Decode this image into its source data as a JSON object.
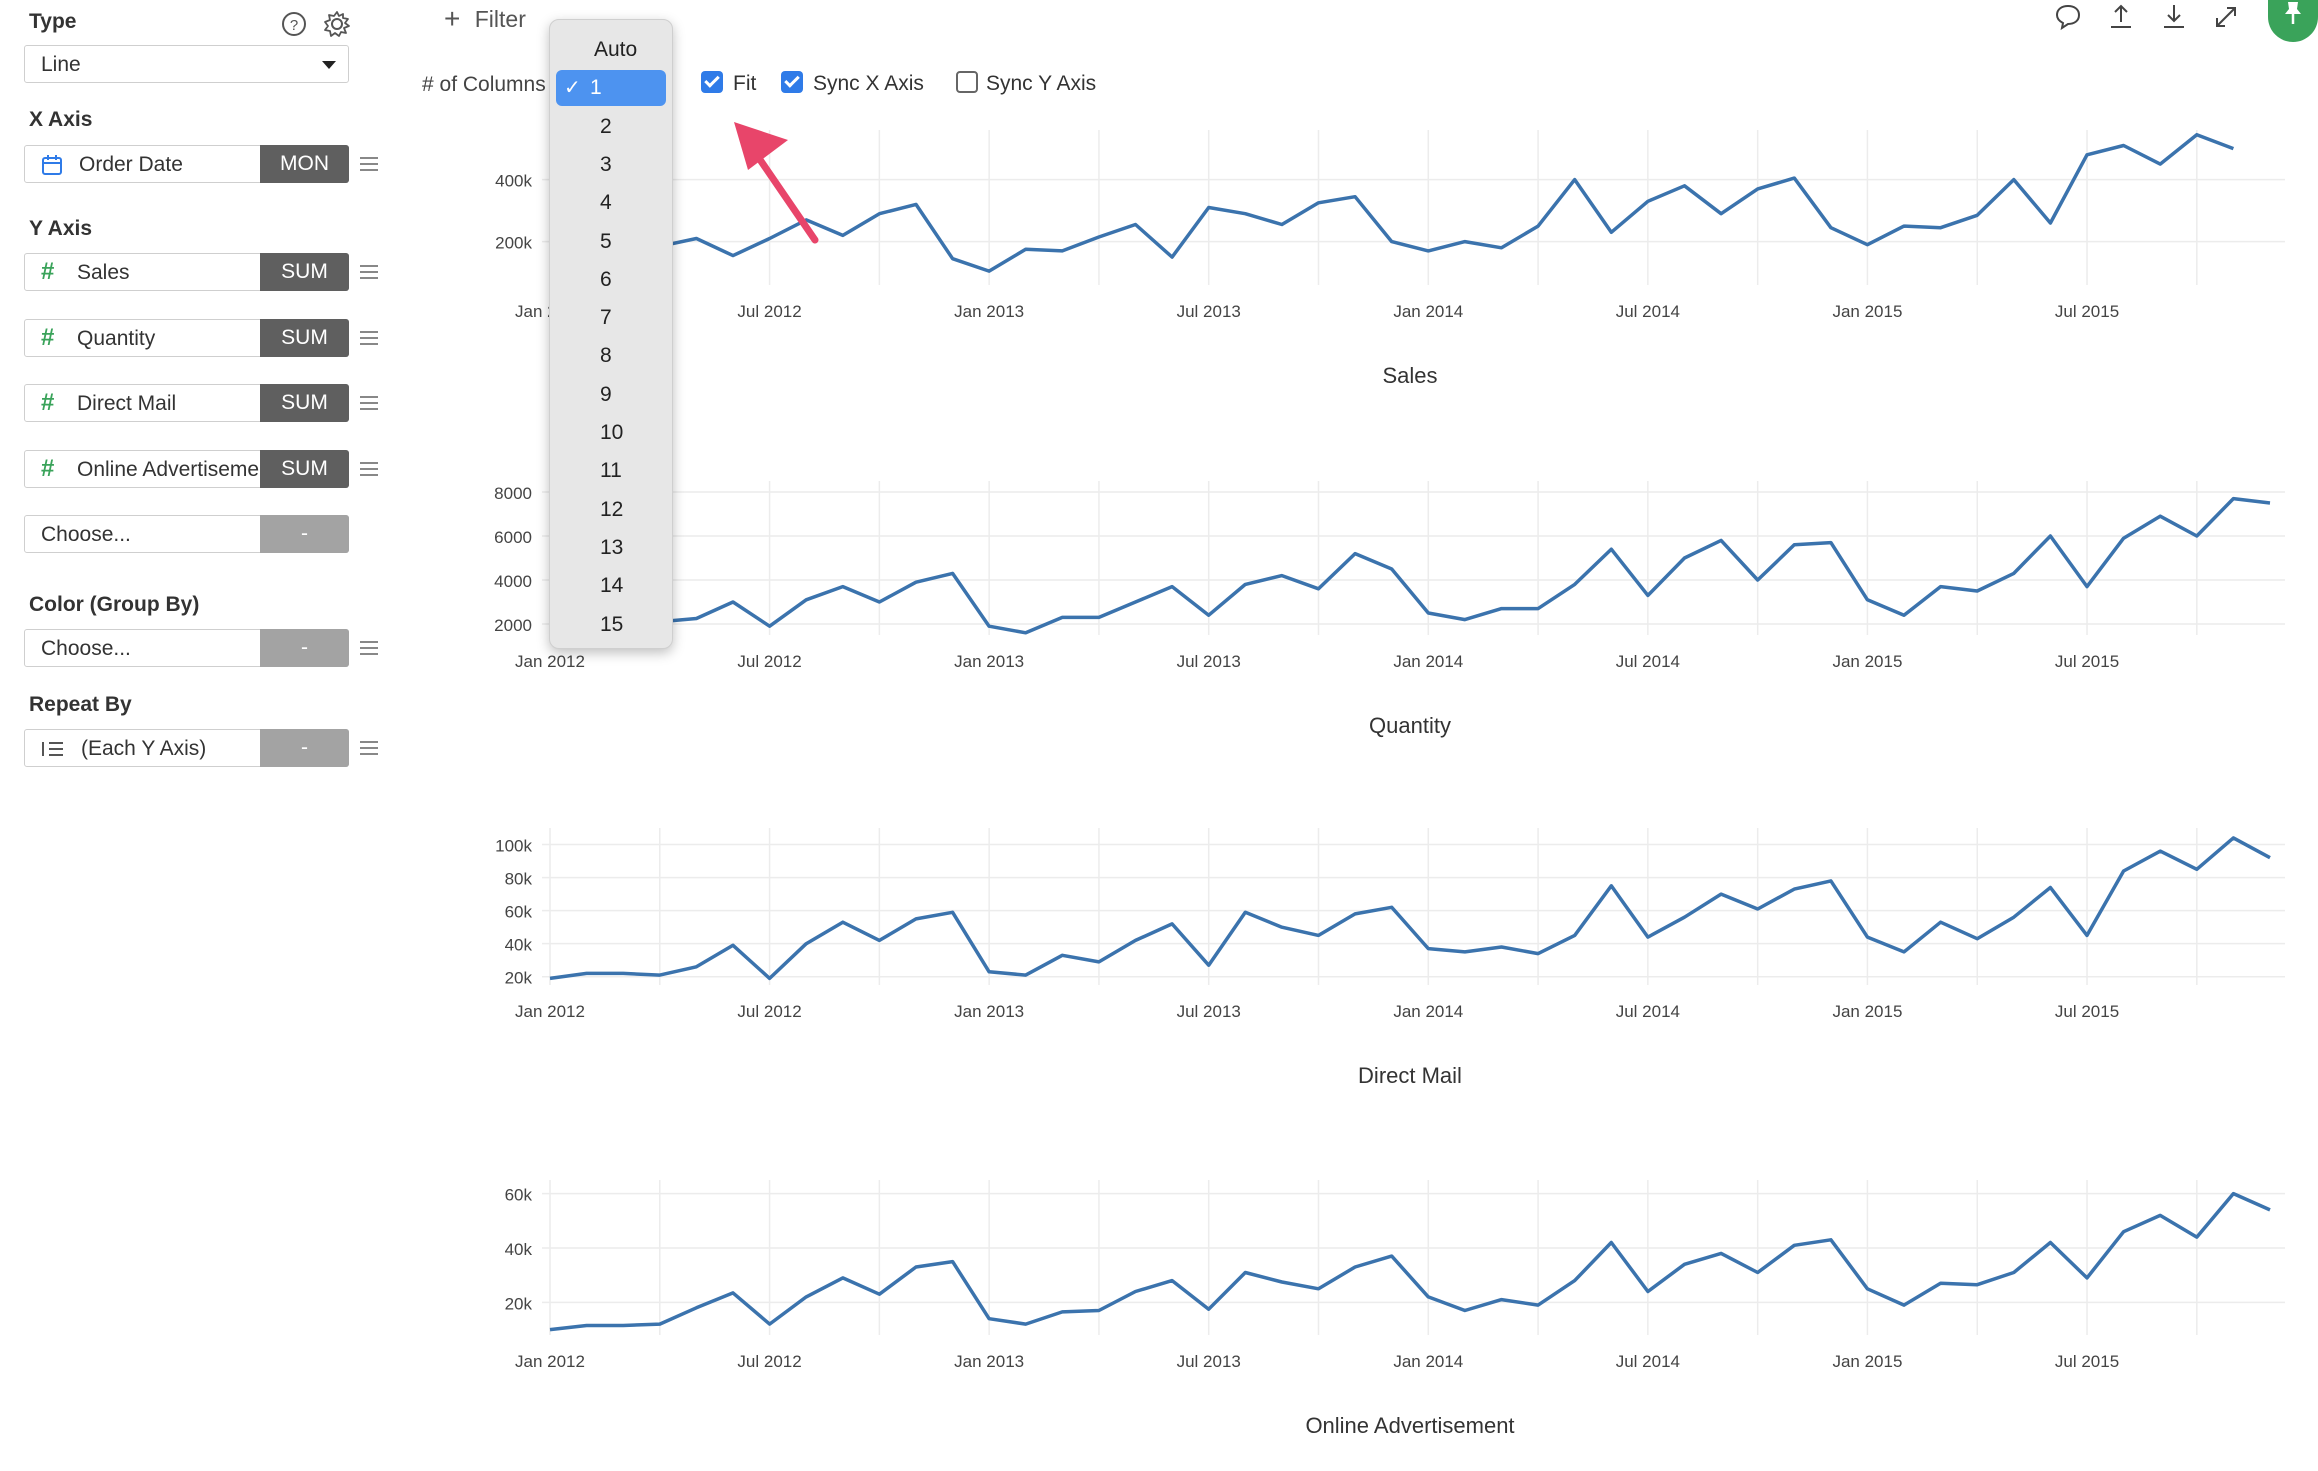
{
  "sidebar": {
    "type": {
      "label": "Type",
      "value": "Line"
    },
    "x_axis": {
      "label": "X Axis",
      "field": "Order Date",
      "agg": "MON"
    },
    "y_axis": {
      "label": "Y Axis",
      "items": [
        {
          "field": "Sales",
          "agg": "SUM"
        },
        {
          "field": "Quantity",
          "agg": "SUM"
        },
        {
          "field": "Direct Mail",
          "agg": "SUM"
        },
        {
          "field": "Online Advertisement",
          "agg": "SUM"
        },
        {
          "field": "Choose...",
          "agg": "-"
        }
      ]
    },
    "color_group": {
      "label": "Color (Group By)",
      "field": "Choose...",
      "agg": "-"
    },
    "repeat_by": {
      "label": "Repeat By",
      "field": "(Each Y Axis)",
      "agg": "-"
    }
  },
  "toolbar": {
    "filter_label": "Filter",
    "columns_label": "# of Columns",
    "fit_label": "Fit",
    "sync_x_label": "Sync X Axis",
    "sync_y_label": "Sync Y Axis",
    "fit_checked": true,
    "sync_x_checked": true,
    "sync_y_checked": false
  },
  "columns_dropdown": {
    "selected": "1",
    "options": [
      "Auto",
      "1",
      "2",
      "3",
      "4",
      "5",
      "6",
      "7",
      "8",
      "9",
      "10",
      "11",
      "12",
      "13",
      "14",
      "15"
    ]
  },
  "colors": {
    "line": "#3b73ad",
    "accent": "#2f7be8",
    "pin": "#3aa35a",
    "arrow": "#e8456a"
  },
  "chart_data": [
    {
      "type": "line",
      "title": "Sales",
      "x_ticks": [
        "Jan 2012",
        "Jul 2012",
        "Jan 2013",
        "Jul 2013",
        "Jan 2014",
        "Jul 2014",
        "Jan 2015",
        "Jul 2015"
      ],
      "y_ticks": [
        "200k",
        "400k"
      ],
      "ylim": [
        60000,
        560000
      ],
      "y_tick_values": [
        200000,
        400000
      ],
      "values": [
        130000,
        120000,
        165000,
        185000,
        210000,
        155000,
        210000,
        270000,
        220000,
        290000,
        320000,
        145000,
        105000,
        175000,
        170000,
        215000,
        255000,
        150000,
        310000,
        290000,
        255000,
        325000,
        345000,
        200000,
        170000,
        200000,
        180000,
        250000,
        400000,
        230000,
        330000,
        380000,
        290000,
        370000,
        405000,
        245000,
        190000,
        250000,
        245000,
        285000,
        400000,
        260000,
        480000,
        510000,
        450000,
        545000,
        500000
      ]
    },
    {
      "type": "line",
      "title": "Quantity",
      "x_ticks": [
        "Jan 2012",
        "Jul 2012",
        "Jan 2013",
        "Jul 2013",
        "Jan 2014",
        "Jul 2014",
        "Jan 2015",
        "Jul 2015"
      ],
      "y_ticks": [
        "2000",
        "4000",
        "6000",
        "8000"
      ],
      "ylim": [
        1500,
        8500
      ],
      "y_tick_values": [
        2000,
        4000,
        6000,
        8000
      ],
      "values": [
        1600,
        1550,
        1800,
        2100,
        2250,
        3000,
        1900,
        3100,
        3700,
        3000,
        3900,
        4300,
        1900,
        1600,
        2300,
        2300,
        3000,
        3700,
        2400,
        3800,
        4200,
        3600,
        5200,
        4500,
        2500,
        2200,
        2700,
        2700,
        3800,
        5400,
        3300,
        5000,
        5800,
        4000,
        5600,
        5700,
        3100,
        2400,
        3700,
        3500,
        4300,
        6000,
        3700,
        5900,
        6900,
        6000,
        7700,
        7500
      ]
    },
    {
      "type": "line",
      "title": "Direct Mail",
      "x_ticks": [
        "Jan 2012",
        "Jul 2012",
        "Jan 2013",
        "Jul 2013",
        "Jan 2014",
        "Jul 2014",
        "Jan 2015",
        "Jul 2015"
      ],
      "y_ticks": [
        "20k",
        "40k",
        "60k",
        "80k",
        "100k"
      ],
      "ylim": [
        15000,
        110000
      ],
      "y_tick_values": [
        20000,
        40000,
        60000,
        80000,
        100000
      ],
      "values": [
        19000,
        22000,
        22000,
        21000,
        26000,
        39000,
        19000,
        40000,
        53000,
        42000,
        55000,
        59000,
        23000,
        21000,
        33000,
        29000,
        42000,
        52000,
        27000,
        59000,
        50000,
        45000,
        58000,
        62000,
        37000,
        35000,
        38000,
        34000,
        45000,
        75000,
        44000,
        56000,
        70000,
        61000,
        73000,
        78000,
        44000,
        35000,
        53000,
        43000,
        56000,
        74000,
        45000,
        84000,
        96000,
        85000,
        104000,
        92000
      ]
    },
    {
      "type": "line",
      "title": "Online Advertisement",
      "x_ticks": [
        "Jan 2012",
        "Jul 2012",
        "Jan 2013",
        "Jul 2013",
        "Jan 2014",
        "Jul 2014",
        "Jan 2015",
        "Jul 2015"
      ],
      "y_ticks": [
        "20k",
        "40k",
        "60k"
      ],
      "ylim": [
        8000,
        65000
      ],
      "y_tick_values": [
        20000,
        40000,
        60000
      ],
      "values": [
        10000,
        11500,
        11500,
        12000,
        18000,
        23500,
        12000,
        22000,
        29000,
        23000,
        33000,
        35000,
        14000,
        12000,
        16500,
        17000,
        24000,
        28000,
        17500,
        31000,
        27500,
        25000,
        33000,
        37000,
        22000,
        17000,
        21000,
        19000,
        28000,
        42000,
        24000,
        34000,
        38000,
        31000,
        41000,
        43000,
        25000,
        19000,
        27000,
        26500,
        31000,
        42000,
        29000,
        46000,
        52000,
        44000,
        60000,
        54000
      ]
    }
  ]
}
